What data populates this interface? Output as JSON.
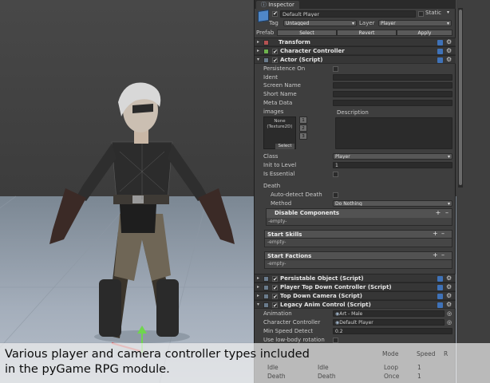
{
  "inspector": {
    "tab_title": "Inspector",
    "object": {
      "name": "Default Player",
      "static_label": "Static",
      "tag_label": "Tag",
      "tag_value": "Untagged",
      "layer_label": "Layer",
      "layer_value": "Player",
      "prefab_label": "Prefab",
      "prefab_buttons": [
        "Select",
        "Revert",
        "Apply"
      ]
    },
    "components_top": [
      {
        "title": "Transform",
        "has_checkbox": false,
        "expanded": false
      },
      {
        "title": "Character Controller",
        "has_checkbox": true,
        "expanded": false
      },
      {
        "title": "Actor (Script)",
        "has_checkbox": true,
        "expanded": true
      }
    ],
    "actor": {
      "persistence_label": "Persistence On",
      "ident_label": "Ident",
      "screen_name_label": "Screen Name",
      "short_name_label": "Short Name",
      "meta_data_label": "Meta Data",
      "images_label": "images",
      "description_label": "Description",
      "texture_none": "None",
      "texture_type": "(Texture2D)",
      "texture_select": "Select",
      "image_slots": [
        "1",
        "2",
        "3"
      ],
      "class_label": "Class",
      "class_value": "Player",
      "init_level_label": "Init to Level",
      "init_level_value": "1",
      "essential_label": "Is Essential",
      "death_label": "Death",
      "auto_detect_label": "Auto-detect Death",
      "method_label": "Method",
      "method_value": "Do Nothing",
      "disable_components_label": "Disable Components",
      "empty_label": "-empty-",
      "start_skills_label": "Start Skills",
      "start_factions_label": "Start Factions"
    },
    "components_bottom": [
      {
        "title": "Persistable Object (Script)"
      },
      {
        "title": "Player Top Down Controller (Script)"
      },
      {
        "title": "Top Down Camera (Script)"
      },
      {
        "title": "Legacy Anim Control (Script)"
      }
    ],
    "anim": {
      "animation_label": "Animation",
      "animation_value": "Art - Male",
      "char_controller_label": "Character Controller",
      "char_controller_value": "Default Player",
      "min_speed_label": "Min Speed Detect",
      "min_speed_value": "0.2",
      "low_body_label": "Use low-body rotation",
      "col_mode": "Mode",
      "col_speed": "Speed",
      "col_r": "R",
      "rows": [
        {
          "name": "Idle",
          "clip": "Idle",
          "mode": "Loop",
          "speed": "1"
        },
        {
          "name": "Death",
          "clip": "Death",
          "mode": "Once",
          "speed": "1"
        }
      ]
    }
  },
  "caption": "Various player and camera controller types included\nin the pyGame RPG module."
}
